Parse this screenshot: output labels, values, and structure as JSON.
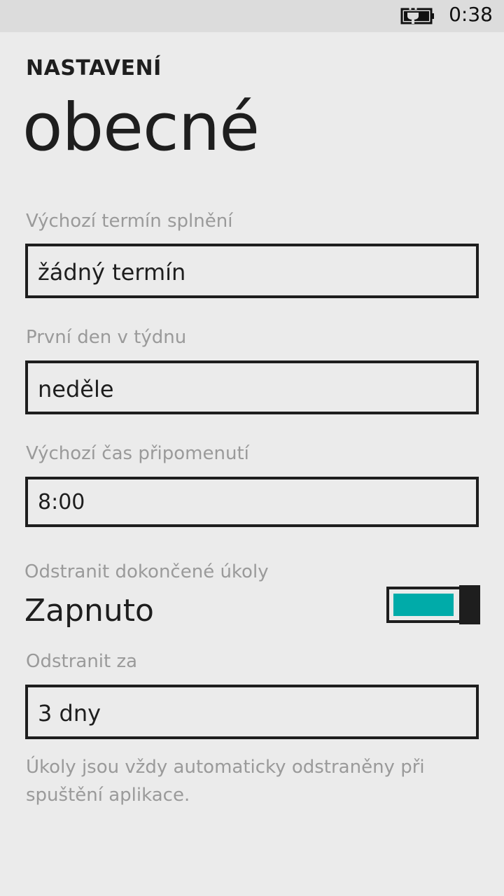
{
  "status_bar": {
    "battery_icon": "battery-charging-icon",
    "time": "0:38"
  },
  "header": {
    "app_title": "NASTAVENÍ",
    "page_title": "obecné"
  },
  "settings": {
    "default_due": {
      "label": "Výchozí termín splnění",
      "value": "žádný termín"
    },
    "first_day": {
      "label": "První den v týdnu",
      "value": "neděle"
    },
    "reminder_time": {
      "label": "Výchozí čas připomenutí",
      "value": "8:00"
    },
    "remove_completed": {
      "label": "Odstranit dokončené úkoly",
      "value": "Zapnuto",
      "on": true,
      "accent_color": "#00aba9"
    },
    "remove_after": {
      "label": "Odstranit za",
      "value": "3 dny"
    },
    "note": "Úkoly jsou vždy automaticky odstraněny při spuštění aplikace."
  }
}
